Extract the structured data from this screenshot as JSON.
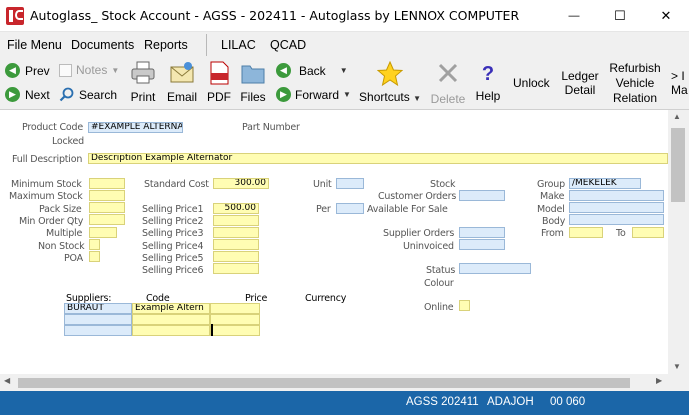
{
  "window": {
    "title": "Autoglass_ Stock Account - AGSS - 202411 - Autoglass by LENNOX COMPUTER",
    "minimize_glyph": "—",
    "maximize_glyph": "☐",
    "close_glyph": "✕"
  },
  "menu": {
    "items": [
      "File Menu",
      "Documents",
      "Reports",
      "LILAC",
      "QCAD"
    ]
  },
  "toolbar": {
    "prev": "Prev",
    "next": "Next",
    "notes": "Notes",
    "search": "Search",
    "print": "Print",
    "email": "Email",
    "pdf": "PDF",
    "files": "Files",
    "back": "Back",
    "forward": "Forward",
    "shortcuts": "Shortcuts",
    "delete": "Delete",
    "help": "Help",
    "unlock": "Unlock",
    "ledger_detail_1": "Ledger",
    "ledger_detail_2": "Detail",
    "refurbish_1": "Refurbish",
    "refurbish_2": "Vehicle",
    "refurbish_3": "Relation",
    "more_1": "> I",
    "more_2": "Ma",
    "pdf_icon_text": "PDF"
  },
  "form": {
    "product_code_label": "Product Code",
    "product_code_value": "#EXAMPLE ALTERNA",
    "part_number_label": "Part Number",
    "locked_label": "Locked",
    "full_description_label": "Full Description",
    "full_description_value": "Description Example Alternator",
    "minimum_stock_label": "Minimum Stock",
    "maximum_stock_label": "Maximum Stock",
    "pack_size_label": "Pack Size",
    "min_order_qty_label": "Min Order Qty",
    "multiple_label": "Multiple",
    "non_stock_label": "Non Stock",
    "poa_label": "POA",
    "standard_cost_label": "Standard Cost",
    "standard_cost_value": "300.00",
    "selling_price1_label": "Selling Price1",
    "selling_price1_value": "500.00",
    "selling_price2_label": "Selling Price2",
    "selling_price3_label": "Selling Price3",
    "selling_price4_label": "Selling Price4",
    "selling_price5_label": "Selling Price5",
    "selling_price6_label": "Selling Price6",
    "unit_label": "Unit",
    "per_label": "Per",
    "stock_label": "Stock",
    "customer_orders_label": "Customer Orders",
    "available_for_sale_label": "Available For Sale",
    "supplier_orders_label": "Supplier Orders",
    "uninvoiced_label": "Uninvoiced",
    "status_label": "Status",
    "colour_label": "Colour",
    "online_label": "Online",
    "group_label": "Group",
    "group_value": "/MEKELEK",
    "make_label": "Make",
    "model_label": "Model",
    "body_label": "Body",
    "from_label": "From",
    "to_label": "To"
  },
  "suppliers": {
    "headers": [
      "Suppliers:",
      "Code",
      "Price",
      "Currency"
    ],
    "rows": [
      [
        "BURAUT",
        "Example Altern",
        "",
        ""
      ],
      [
        "",
        "",
        "",
        ""
      ],
      [
        "",
        "",
        "",
        ""
      ]
    ]
  },
  "statusbar": {
    "system": "AGSS 202411",
    "user": "ADAJOH",
    "code": "00 060"
  },
  "colors": {
    "field_yellow": "#fffdb3",
    "field_blue": "#dcebfa",
    "statusbar": "#1b66a8"
  }
}
